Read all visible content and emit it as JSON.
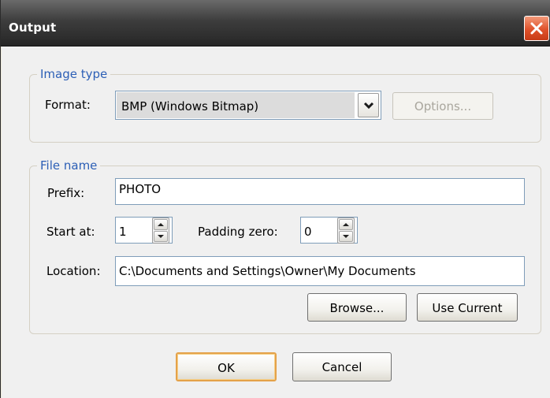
{
  "window": {
    "title": "Output"
  },
  "image_type": {
    "legend": "Image type",
    "format_label": "Format:",
    "format_value": "BMP (Windows Bitmap)",
    "options_label": "Options..."
  },
  "file_name": {
    "legend": "File name",
    "prefix_label": "Prefix:",
    "prefix_value": "PHOTO",
    "start_label": "Start at:",
    "start_value": "1",
    "padding_label": "Padding zero:",
    "padding_value": "0",
    "location_label": "Location:",
    "location_value": "C:\\Documents and Settings\\Owner\\My Documents",
    "browse_label": "Browse...",
    "use_current_label": "Use Current"
  },
  "footer": {
    "ok_label": "OK",
    "cancel_label": "Cancel"
  },
  "icons": {
    "close": "close-icon",
    "dropdown": "chevron-down-icon",
    "spin_up": "arrow-up-icon",
    "spin_down": "arrow-down-icon"
  }
}
